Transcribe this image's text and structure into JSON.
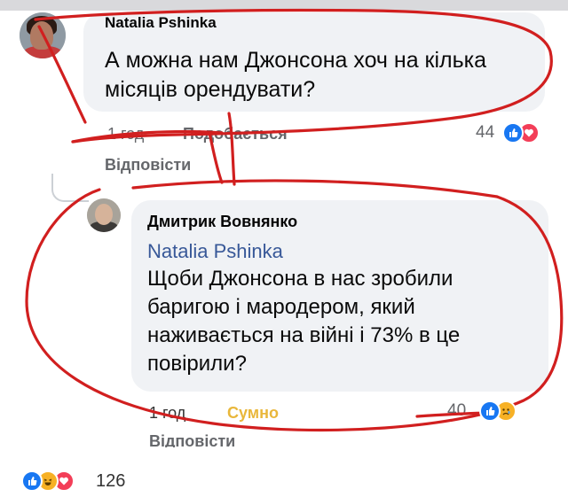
{
  "comment": {
    "author": "Natalia Pshinka",
    "text": "А можна нам Джонсона хоч на кілька місяців орендувати?",
    "time": "1 год",
    "like_label": "Подобається",
    "reply_label": "Відповісти",
    "reaction_count": "44",
    "reactions": [
      "like-icon",
      "love-icon"
    ]
  },
  "reply": {
    "author": "Дмитрик Вовнянко",
    "mention": "Natalia Pshinka",
    "text": "Щоби Джонсона в нас зробили баригою і мародером, який наживається на війні і 73% в це повірили?",
    "time": "1 год",
    "reaction_label": "Сумно",
    "reply_label": "Відповісти",
    "reaction_count": "40",
    "reactions": [
      "like-icon",
      "sad-icon"
    ]
  },
  "post_reactions": {
    "icons": [
      "like-icon",
      "haha-icon",
      "love-icon"
    ],
    "count": "126"
  },
  "colors": {
    "bubble": "#f0f2f5",
    "mention": "#385898",
    "annotation_red": "#d11f1f",
    "like_blue": "#1877f2",
    "love_red": "#f33e58",
    "sad_yellow": "#f7b125"
  }
}
